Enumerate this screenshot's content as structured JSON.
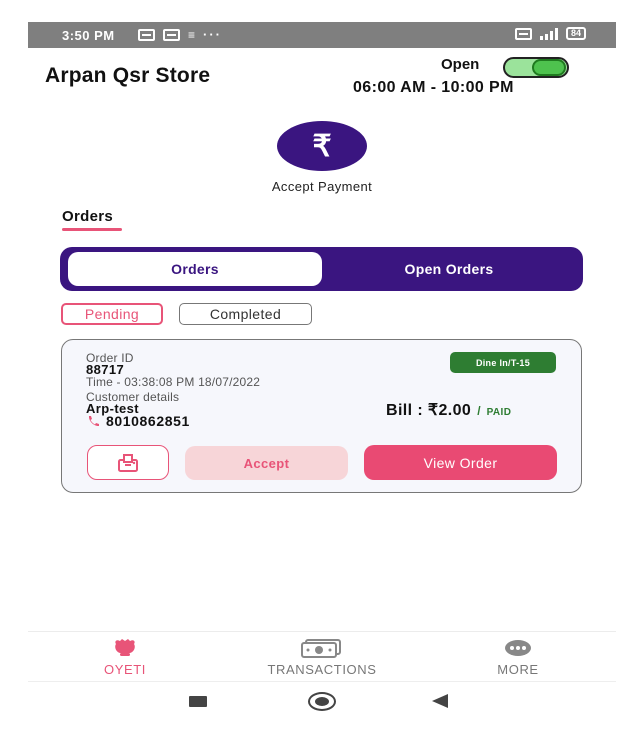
{
  "status_bar": {
    "time": "3:50 PM",
    "more_dots": "···",
    "battery": "84"
  },
  "header": {
    "store_name": "Arpan Qsr Store",
    "open_label": "Open",
    "open_toggle_on": true,
    "hours": "06:00 AM - 10:00 PM"
  },
  "payment": {
    "symbol": "₹",
    "label": "Accept Payment"
  },
  "orders_section": {
    "heading": "Orders",
    "tabs": [
      {
        "label": "Orders",
        "active": true
      },
      {
        "label": "Open Orders",
        "active": false
      }
    ],
    "filters": [
      {
        "label": "Pending",
        "selected": true
      },
      {
        "label": "Completed",
        "selected": false
      }
    ]
  },
  "order": {
    "id_label": "Order ID",
    "id": "88717",
    "time": "Time - 03:38:08 PM 18/07/2022",
    "customer_label": "Customer details",
    "customer_name": "Arp-test",
    "phone": "8010862851",
    "badge": "Dine In/T-15",
    "bill": "Bill : ₹2.00",
    "separator": "/",
    "status": "PAID",
    "accept_label": "Accept",
    "view_label": "View Order"
  },
  "bottom_nav": [
    {
      "label": "OYETI",
      "icon": "oyeti-icon",
      "active": true
    },
    {
      "label": "TRANSACTIONS",
      "icon": "cash-icon",
      "active": false
    },
    {
      "label": "MORE",
      "icon": "more-dots-icon",
      "active": false
    }
  ],
  "colors": {
    "brand_purple": "#3a1580",
    "accent_pink": "#e85478",
    "paid_green": "#2e7d32",
    "toggle_green": "#4ec24e"
  }
}
